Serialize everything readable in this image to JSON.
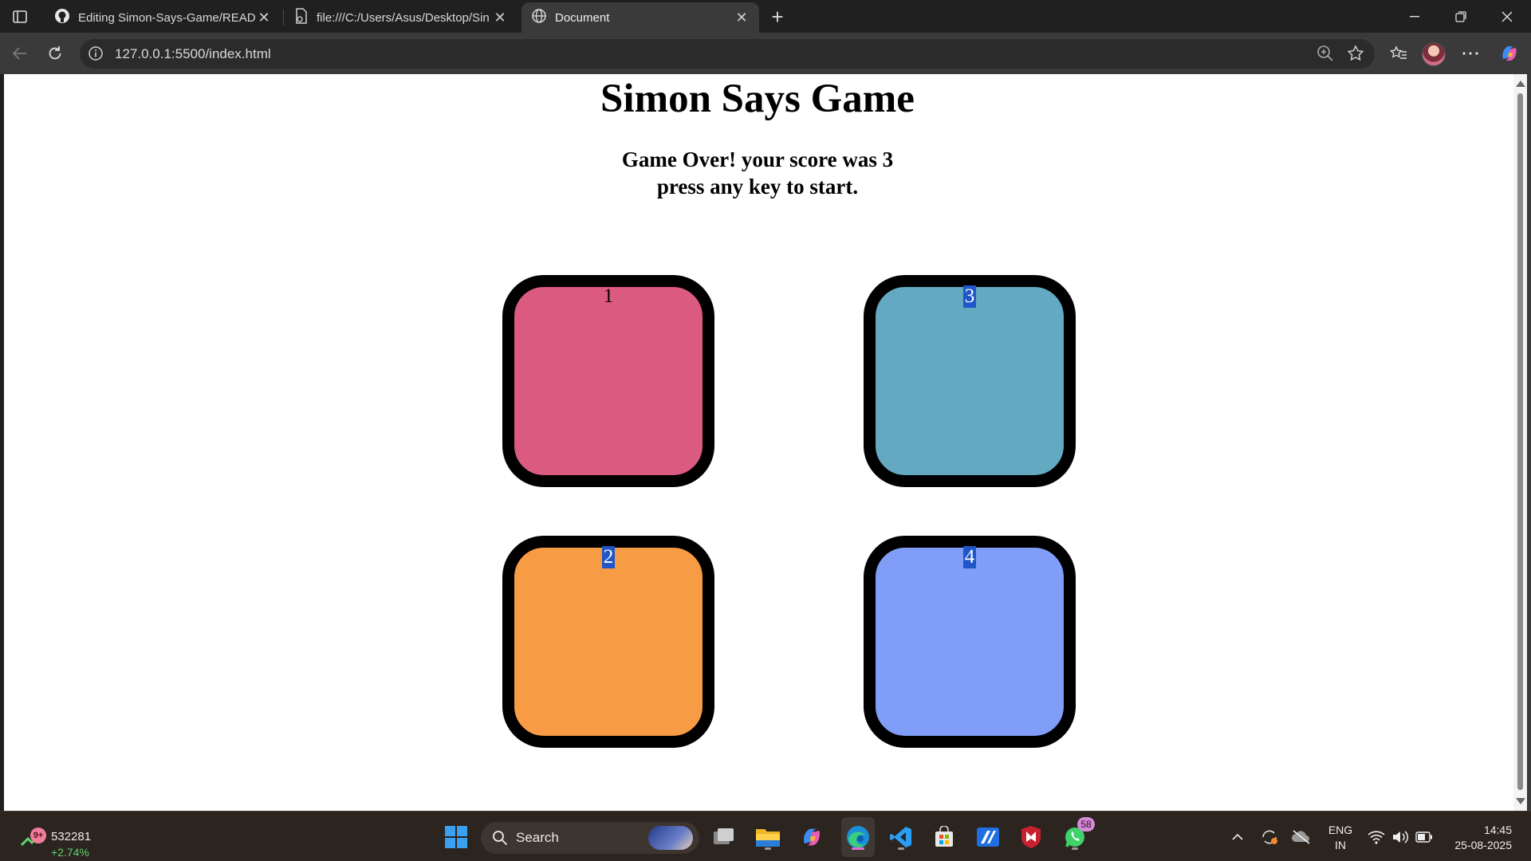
{
  "browser": {
    "tabs": [
      {
        "title": "Editing Simon-Says-Game/READM",
        "icon": "github-icon"
      },
      {
        "title": "file:///C:/Users/Asus/Desktop/Sin",
        "icon": "file-icon"
      },
      {
        "title": "Document",
        "icon": "globe-icon",
        "active": true
      }
    ],
    "url": "127.0.0.1:5500/index.html"
  },
  "page": {
    "title": "Simon Says Game",
    "status_line1": "Game Over! your score was 3",
    "status_line2": "press any key to start.",
    "buttons": [
      {
        "label": "1",
        "color": "#db5a80"
      },
      {
        "label": "3",
        "color": "#63a9c1"
      },
      {
        "label": "2",
        "color": "#f89b45"
      },
      {
        "label": "4",
        "color": "#809ef8"
      }
    ]
  },
  "taskbar": {
    "widget_badge": "9+",
    "widget_value": "532281",
    "widget_change": "+2.74%",
    "search_label": "Search",
    "whatsapp_badge": "58",
    "lang_line1": "ENG",
    "lang_line2": "IN",
    "time": "14:45",
    "date": "25-08-2025"
  }
}
